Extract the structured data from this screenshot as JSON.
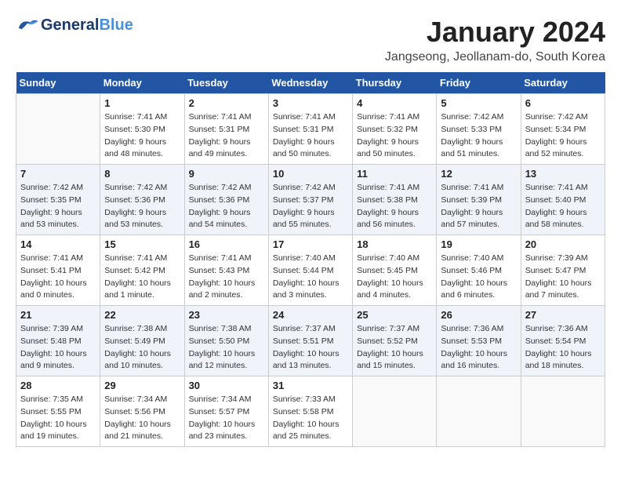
{
  "header": {
    "logo": {
      "general": "General",
      "blue": "Blue"
    },
    "title": "January 2024",
    "location": "Jangseong, Jeollanam-do, South Korea"
  },
  "days_of_week": [
    "Sunday",
    "Monday",
    "Tuesday",
    "Wednesday",
    "Thursday",
    "Friday",
    "Saturday"
  ],
  "weeks": [
    [
      {
        "day": "",
        "sunrise": "",
        "sunset": "",
        "daylight": ""
      },
      {
        "day": "1",
        "sunrise": "Sunrise: 7:41 AM",
        "sunset": "Sunset: 5:30 PM",
        "daylight": "Daylight: 9 hours and 48 minutes."
      },
      {
        "day": "2",
        "sunrise": "Sunrise: 7:41 AM",
        "sunset": "Sunset: 5:31 PM",
        "daylight": "Daylight: 9 hours and 49 minutes."
      },
      {
        "day": "3",
        "sunrise": "Sunrise: 7:41 AM",
        "sunset": "Sunset: 5:31 PM",
        "daylight": "Daylight: 9 hours and 50 minutes."
      },
      {
        "day": "4",
        "sunrise": "Sunrise: 7:41 AM",
        "sunset": "Sunset: 5:32 PM",
        "daylight": "Daylight: 9 hours and 50 minutes."
      },
      {
        "day": "5",
        "sunrise": "Sunrise: 7:42 AM",
        "sunset": "Sunset: 5:33 PM",
        "daylight": "Daylight: 9 hours and 51 minutes."
      },
      {
        "day": "6",
        "sunrise": "Sunrise: 7:42 AM",
        "sunset": "Sunset: 5:34 PM",
        "daylight": "Daylight: 9 hours and 52 minutes."
      }
    ],
    [
      {
        "day": "7",
        "sunrise": "Sunrise: 7:42 AM",
        "sunset": "Sunset: 5:35 PM",
        "daylight": "Daylight: 9 hours and 53 minutes."
      },
      {
        "day": "8",
        "sunrise": "Sunrise: 7:42 AM",
        "sunset": "Sunset: 5:36 PM",
        "daylight": "Daylight: 9 hours and 53 minutes."
      },
      {
        "day": "9",
        "sunrise": "Sunrise: 7:42 AM",
        "sunset": "Sunset: 5:36 PM",
        "daylight": "Daylight: 9 hours and 54 minutes."
      },
      {
        "day": "10",
        "sunrise": "Sunrise: 7:42 AM",
        "sunset": "Sunset: 5:37 PM",
        "daylight": "Daylight: 9 hours and 55 minutes."
      },
      {
        "day": "11",
        "sunrise": "Sunrise: 7:41 AM",
        "sunset": "Sunset: 5:38 PM",
        "daylight": "Daylight: 9 hours and 56 minutes."
      },
      {
        "day": "12",
        "sunrise": "Sunrise: 7:41 AM",
        "sunset": "Sunset: 5:39 PM",
        "daylight": "Daylight: 9 hours and 57 minutes."
      },
      {
        "day": "13",
        "sunrise": "Sunrise: 7:41 AM",
        "sunset": "Sunset: 5:40 PM",
        "daylight": "Daylight: 9 hours and 58 minutes."
      }
    ],
    [
      {
        "day": "14",
        "sunrise": "Sunrise: 7:41 AM",
        "sunset": "Sunset: 5:41 PM",
        "daylight": "Daylight: 10 hours and 0 minutes."
      },
      {
        "day": "15",
        "sunrise": "Sunrise: 7:41 AM",
        "sunset": "Sunset: 5:42 PM",
        "daylight": "Daylight: 10 hours and 1 minute."
      },
      {
        "day": "16",
        "sunrise": "Sunrise: 7:41 AM",
        "sunset": "Sunset: 5:43 PM",
        "daylight": "Daylight: 10 hours and 2 minutes."
      },
      {
        "day": "17",
        "sunrise": "Sunrise: 7:40 AM",
        "sunset": "Sunset: 5:44 PM",
        "daylight": "Daylight: 10 hours and 3 minutes."
      },
      {
        "day": "18",
        "sunrise": "Sunrise: 7:40 AM",
        "sunset": "Sunset: 5:45 PM",
        "daylight": "Daylight: 10 hours and 4 minutes."
      },
      {
        "day": "19",
        "sunrise": "Sunrise: 7:40 AM",
        "sunset": "Sunset: 5:46 PM",
        "daylight": "Daylight: 10 hours and 6 minutes."
      },
      {
        "day": "20",
        "sunrise": "Sunrise: 7:39 AM",
        "sunset": "Sunset: 5:47 PM",
        "daylight": "Daylight: 10 hours and 7 minutes."
      }
    ],
    [
      {
        "day": "21",
        "sunrise": "Sunrise: 7:39 AM",
        "sunset": "Sunset: 5:48 PM",
        "daylight": "Daylight: 10 hours and 9 minutes."
      },
      {
        "day": "22",
        "sunrise": "Sunrise: 7:38 AM",
        "sunset": "Sunset: 5:49 PM",
        "daylight": "Daylight: 10 hours and 10 minutes."
      },
      {
        "day": "23",
        "sunrise": "Sunrise: 7:38 AM",
        "sunset": "Sunset: 5:50 PM",
        "daylight": "Daylight: 10 hours and 12 minutes."
      },
      {
        "day": "24",
        "sunrise": "Sunrise: 7:37 AM",
        "sunset": "Sunset: 5:51 PM",
        "daylight": "Daylight: 10 hours and 13 minutes."
      },
      {
        "day": "25",
        "sunrise": "Sunrise: 7:37 AM",
        "sunset": "Sunset: 5:52 PM",
        "daylight": "Daylight: 10 hours and 15 minutes."
      },
      {
        "day": "26",
        "sunrise": "Sunrise: 7:36 AM",
        "sunset": "Sunset: 5:53 PM",
        "daylight": "Daylight: 10 hours and 16 minutes."
      },
      {
        "day": "27",
        "sunrise": "Sunrise: 7:36 AM",
        "sunset": "Sunset: 5:54 PM",
        "daylight": "Daylight: 10 hours and 18 minutes."
      }
    ],
    [
      {
        "day": "28",
        "sunrise": "Sunrise: 7:35 AM",
        "sunset": "Sunset: 5:55 PM",
        "daylight": "Daylight: 10 hours and 19 minutes."
      },
      {
        "day": "29",
        "sunrise": "Sunrise: 7:34 AM",
        "sunset": "Sunset: 5:56 PM",
        "daylight": "Daylight: 10 hours and 21 minutes."
      },
      {
        "day": "30",
        "sunrise": "Sunrise: 7:34 AM",
        "sunset": "Sunset: 5:57 PM",
        "daylight": "Daylight: 10 hours and 23 minutes."
      },
      {
        "day": "31",
        "sunrise": "Sunrise: 7:33 AM",
        "sunset": "Sunset: 5:58 PM",
        "daylight": "Daylight: 10 hours and 25 minutes."
      },
      {
        "day": "",
        "sunrise": "",
        "sunset": "",
        "daylight": ""
      },
      {
        "day": "",
        "sunrise": "",
        "sunset": "",
        "daylight": ""
      },
      {
        "day": "",
        "sunrise": "",
        "sunset": "",
        "daylight": ""
      }
    ]
  ]
}
